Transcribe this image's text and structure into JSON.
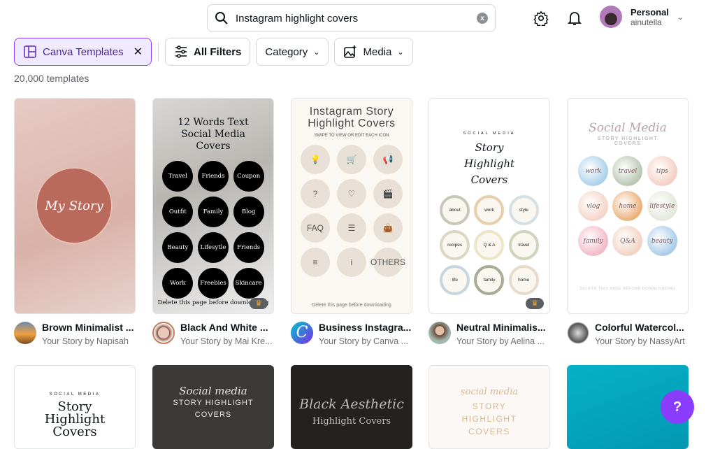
{
  "search": {
    "value": "Instagram highlight covers",
    "clear_label": "x"
  },
  "account": {
    "name": "Personal",
    "username": "ainutella"
  },
  "filters": {
    "canva_templates": "Canva Templates",
    "all_filters": "All Filters",
    "category": "Category",
    "media": "Media"
  },
  "result_count": "20,000 templates",
  "templates": [
    {
      "title": "Brown Minimalist ...",
      "subtitle": "Your Story by Napisah",
      "thumb": {
        "text": "My Story"
      }
    },
    {
      "title": "Black And White ...",
      "subtitle": "Your Story by Mai Kre...",
      "thumb": {
        "heading": "12 Words Text Social Media Covers",
        "items": [
          "Travel",
          "Friends",
          "Coupon",
          "Outfit",
          "Family",
          "Blog",
          "Beauty",
          "Lifesytle",
          "Friends",
          "Work",
          "Freebies",
          "Skincare"
        ],
        "footer": "Delete this page before downloading"
      },
      "premium": true
    },
    {
      "title": "Business Instagra...",
      "subtitle": "Your Story by Canva ...",
      "thumb": {
        "heading": "Instagram Story Highlight Covers",
        "sub": "SWIPE TO VIEW OR EDIT EACH ICON",
        "items": [
          "💡",
          "🛒",
          "📢",
          "?",
          "♡",
          "🎬",
          "FAQ",
          "☰",
          "👜",
          "≡",
          "i",
          "OTHERS"
        ],
        "footer": "Delete this page before downloading"
      }
    },
    {
      "title": "Neutral Minimalis...",
      "subtitle": "Your Story by Aelina ...",
      "thumb": {
        "kicker": "SOCIAL MEDIA",
        "heading": "Story Highlight Covers",
        "items": [
          "about",
          "work",
          "style",
          "recipes",
          "Q & A",
          "travel",
          "life",
          "family",
          "home"
        ]
      },
      "premium": true
    },
    {
      "title": "Colorful Watercol...",
      "subtitle": "Your Story by NassyArt",
      "thumb": {
        "heading": "Social Media",
        "sub": "STORY HIGHLIGHT COVERS",
        "items": [
          "work",
          "travel",
          "tips",
          "vlog",
          "home",
          "lifestyle",
          "family",
          "Q&A",
          "beauty"
        ],
        "footer": "DELETE THIS PAGE BEFORE DOWNLOADING"
      }
    }
  ],
  "row2": [
    {
      "kicker": "SOCIAL MEDIA",
      "heading": "Story Highlight Covers"
    },
    {
      "kicker": "Social media",
      "heading": "STORY HIGHLIGHT COVERS"
    },
    {
      "kicker": "Black Aesthetic",
      "heading": "Highlight Covers"
    },
    {
      "kicker": "social media",
      "heading": "STORY HIGHLIGHT COVERS"
    },
    {
      "kicker": "",
      "heading": ""
    }
  ],
  "help_label": "?",
  "colors": {
    "accent": "#8b3dff",
    "chip_active_bg": "#f0eafe",
    "premium_crown": "#f5a623"
  }
}
